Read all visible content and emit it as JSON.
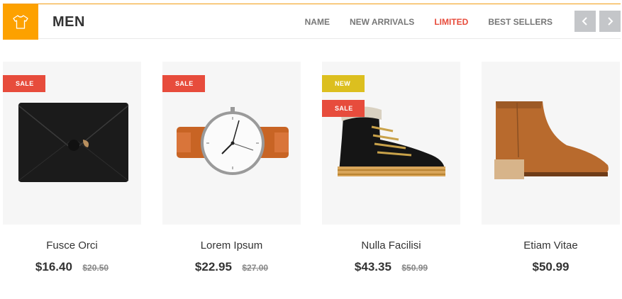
{
  "category": {
    "title": "MEN",
    "icon": "tshirt-icon"
  },
  "tabs": [
    {
      "label": "NAME",
      "active": false
    },
    {
      "label": "NEW ARRIVALS",
      "active": false
    },
    {
      "label": "LIMITED",
      "active": true
    },
    {
      "label": "BEST SELLERS",
      "active": false
    }
  ],
  "nav": {
    "prev_icon": "chevron-left-icon",
    "next_icon": "chevron-right-icon"
  },
  "colors": {
    "accent": "#fda100",
    "active_tab": "#e74c3c",
    "sale": "#e74c3c",
    "new": "#dcbf1f"
  },
  "products": [
    {
      "name": "Fusce Orci",
      "price": "$16.40",
      "old_price": "$20.50",
      "badges": [
        "SALE"
      ],
      "image": "clutch-bag"
    },
    {
      "name": "Lorem Ipsum",
      "price": "$22.95",
      "old_price": "$27.00",
      "badges": [
        "SALE"
      ],
      "image": "wristwatch"
    },
    {
      "name": "Nulla Facilisi",
      "price": "$43.35",
      "old_price": "$50.99",
      "badges": [
        "NEW",
        "SALE"
      ],
      "image": "winter-boot"
    },
    {
      "name": "Etiam Vitae",
      "price": "$50.99",
      "old_price": "",
      "badges": [],
      "image": "ankle-boot"
    }
  ]
}
